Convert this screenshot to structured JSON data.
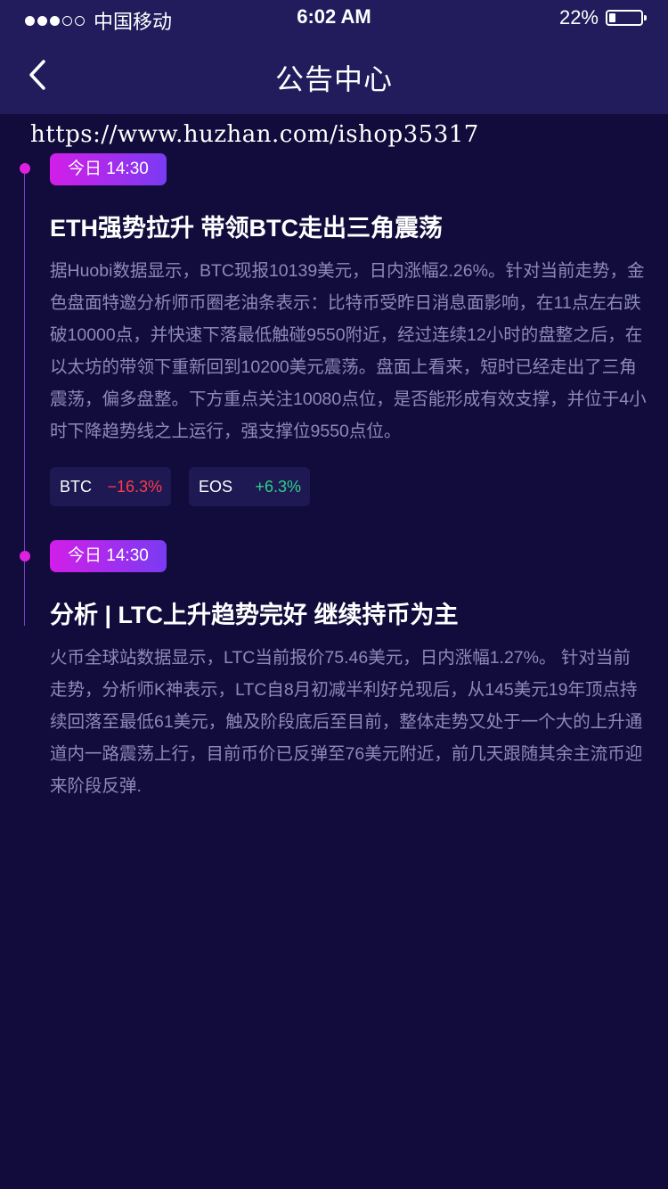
{
  "status_bar": {
    "carrier": "中国移动",
    "time": "6:02 AM",
    "battery": "22%",
    "battery_level": 0.22
  },
  "nav": {
    "title": "公告中心",
    "back_icon": "chevron-left-icon"
  },
  "watermark": "https://www.huzhan.com/ishop35317",
  "articles": [
    {
      "time": "今日 14:30",
      "title": "ETH强势拉升 带领BTC走出三角震荡",
      "body": "据Huobi数据显示，BTC现报10139美元，日内涨幅2.26%。针对当前走势，金色盘面特邀分析师币圈老油条表示：比特币受昨日消息面影响，在11点左右跌破10000点，并快速下落最低触碰9550附近，经过连续12小时的盘整之后，在以太坊的带领下重新回到10200美元震荡。盘面上看来，短时已经走出了三角震荡，偏多盘整。下方重点关注10080点位，是否能形成有效支撑，并位于4小时下降趋势线之上运行，强支撑位9550点位。",
      "tags": [
        {
          "name": "BTC",
          "change": "−16.3%"
        },
        {
          "name": "EOS",
          "change": "+6.3%"
        }
      ]
    },
    {
      "time": "今日 14:30",
      "title": "分析 | LTC上升趋势完好 继续持币为主",
      "body": "火币全球站数据显示，LTC当前报价75.46美元，日内涨幅1.27%。 针对当前走势，分析师K神表示，LTC自8月初减半利好兑现后，从145美元19年顶点持续回落至最低61美元，触及阶段底后至目前，整体走势又处于一个大的上升通道内一路震荡上行，目前币价已反弹至76美元附近，前几天跟随其余主流币迎来阶段反弹."
    }
  ],
  "colors": {
    "background": "#110c3c",
    "header": "#221c5c",
    "accent_start": "#d21ee8",
    "accent_end": "#7a3bf2",
    "down": "#ff3a4a",
    "up": "#2fd08a"
  }
}
